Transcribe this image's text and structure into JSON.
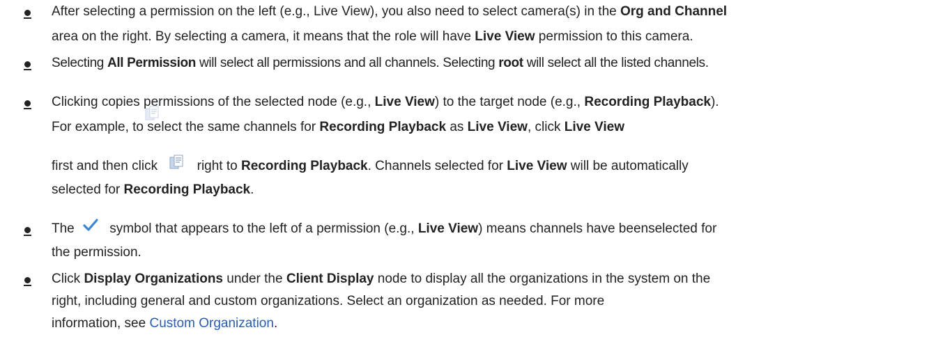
{
  "bullets": [
    {
      "line1": {
        "pre": "After selecting a permission on the left (e.g., Live View), you also need to select camera(s) in the ",
        "b1": "Org and Channel"
      },
      "line2": {
        "pre": "area on the right. By selecting a camera, it means that the role will have ",
        "b1": "Live View",
        "post": "  permission to this camera."
      }
    },
    {
      "line1": {
        "pre": "Selecting ",
        "b1": "All Permission",
        "mid": " will select all permissions and all channels. Selecting ",
        "b2": "root",
        "post": " will select all the listed channels."
      }
    },
    {
      "line1": {
        "pre": "Clicking ",
        "icon": "copy-permissions-icon",
        "mid": "copies permissions of the selected node (e.g., ",
        "b1": "Live View",
        "mid2": ") to the target node (e.g., ",
        "b2": "Recording Playback",
        "post": ")."
      },
      "line2": {
        "pre": "For example, to select the same channels for ",
        "b1": "Recording Playback",
        "mid": " as ",
        "b2": "Live View",
        "mid2": ", click ",
        "b3": "Live View"
      },
      "line3": {
        "pre": "first and then click ",
        "icon": "copy-permissions-icon",
        "mid": " right to ",
        "b1": "Recording Playback",
        "mid2": ". Channels selected for ",
        "b2": "Live View",
        "post": " will be automatically"
      },
      "line4": {
        "pre": "selected for ",
        "b1": "Recording Playback",
        "post": "."
      }
    },
    {
      "line1": {
        "pre": "The ",
        "icon": "checkmark-icon",
        "mid": " symbol that appears to the left of a permission (e.g., ",
        "b1": "Live View",
        "post": ") means channels have  beenselected for"
      },
      "line2": {
        "pre": "the permission."
      }
    },
    {
      "line1": {
        "pre": "Click ",
        "b1": "Display Organizations",
        "mid": " under the ",
        "b2": "Client Display",
        "post": " node to display all the organizations in the system on the"
      },
      "line2": {
        "pre": "right, including general and custom organizations. Select an organization as needed. For more"
      },
      "line3": {
        "pre": "information, see ",
        "link": "Custom Organization",
        "post": "."
      }
    }
  ],
  "colors": {
    "text": "#222222",
    "link": "#2a5db0",
    "check": "#3a86d6",
    "copy_icon": "#8fa6c8"
  }
}
